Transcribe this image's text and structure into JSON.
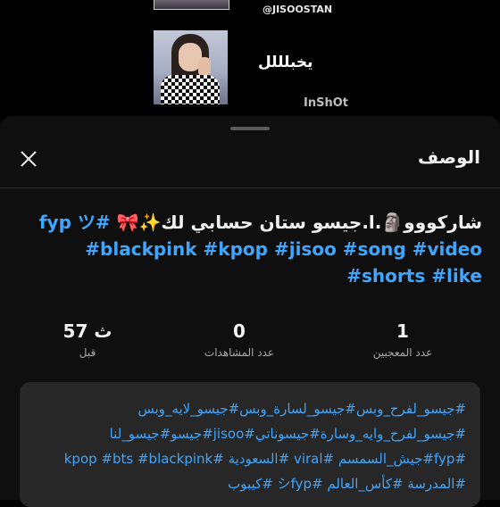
{
  "video": {
    "handle": "@JISOOSTAN",
    "overlay_caption": "يخبلللل",
    "watermark": "InShOt"
  },
  "sheet": {
    "title": "الوصف",
    "video_title_text": "شاركووو🗿.ا.جيسو ستان حسابي لك✨🎀 ",
    "video_title_tags": [
      "#fyp",
      "#blackpink",
      "#kpop",
      "#jisoo",
      "#song",
      "#video",
      "#shorts",
      "#like"
    ],
    "title_suffix": "ツ"
  },
  "stats": [
    {
      "value": "1",
      "label": "عدد المعجبين"
    },
    {
      "value": "0",
      "label": "عدد المشاهدات"
    },
    {
      "value": "57 ث",
      "label": "قبل"
    }
  ],
  "description": {
    "lines": [
      "#جيسو_لفرح_وبس#جيسو_لسارة_وبس#جيسو_لايه_وبس",
      "#جيسو_لفرح_وايه_وسارة#جيسوناتي#jisoo#جيسو#جيسو_لنا",
      "#fyp#جيش_السمسم #viral #السعودية #kpop #bts #blackpink",
      "#المدرسة #كأس_العالم #シfyp #كيبوب"
    ]
  },
  "icons": {
    "close": "close-icon"
  },
  "colors": {
    "link": "#3ea6ff",
    "sheet_bg": "#0f0f0f",
    "desc_bg": "#272727"
  }
}
